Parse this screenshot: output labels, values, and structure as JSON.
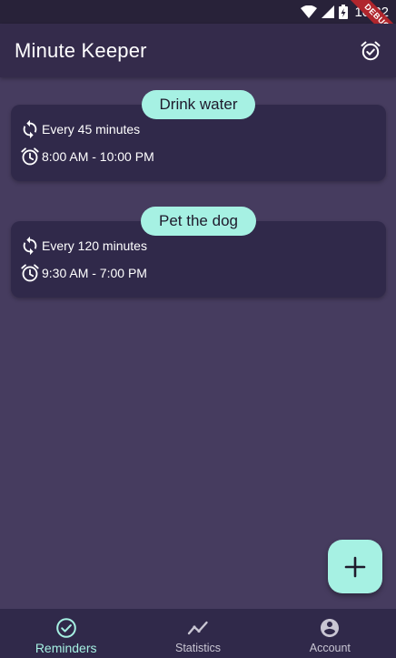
{
  "status_bar": {
    "time": "10:32",
    "debug_label": "DEBUG"
  },
  "app_bar": {
    "title": "Minute Keeper",
    "action_icon": "alarm-check-icon"
  },
  "reminders": [
    {
      "title": "Drink water",
      "frequency": "Every 45 minutes",
      "time_range": "8:00 AM - 10:00 PM"
    },
    {
      "title": "Pet the dog",
      "frequency": "Every 120 minutes",
      "time_range": "9:30 AM - 7:00 PM"
    }
  ],
  "fab": {
    "icon": "plus-icon"
  },
  "bottom_nav": {
    "items": [
      {
        "label": "Reminders",
        "icon": "check-circle-icon",
        "active": true
      },
      {
        "label": "Statistics",
        "icon": "chart-line-icon",
        "active": false
      },
      {
        "label": "Account",
        "icon": "account-circle-icon",
        "active": false
      }
    ]
  },
  "colors": {
    "accent": "#a6f1e3",
    "background": "#463c5f",
    "app_bar": "#342b4b",
    "card": "#30294a",
    "status_bar": "#282239",
    "debug_ribbon": "#b0262d"
  }
}
